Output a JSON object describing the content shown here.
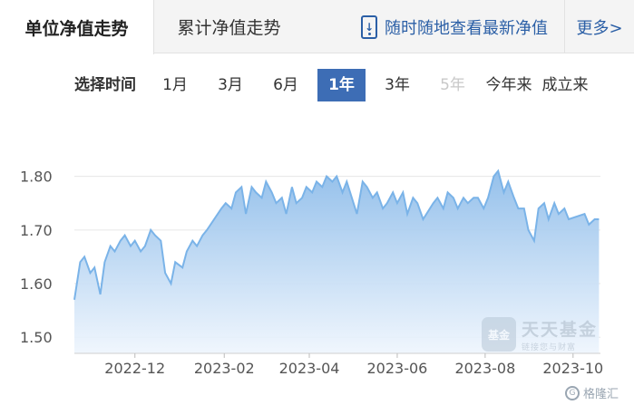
{
  "tabs": {
    "nav_trend": "单位净值走势",
    "total_trend": "累计净值走势"
  },
  "promo": {
    "label": "随时随地查看最新净值"
  },
  "more": {
    "label": "更多>"
  },
  "period": {
    "label": "选择时间",
    "options": [
      "1月",
      "3月",
      "6月",
      "1年",
      "3年",
      "5年",
      "今年来",
      "成立来"
    ],
    "selected": "1年",
    "disabled": [
      "5年"
    ]
  },
  "watermark": {
    "title": "天天基金",
    "subtitle": "链接您与财富",
    "logo_text": "基金"
  },
  "corner_badge": "格隆汇",
  "colors": {
    "line": "#7ab3e8",
    "fill_top": "#8fbdea",
    "fill_bottom": "#eef5fd",
    "active": "#3d6db5",
    "link": "#2b5fa6"
  },
  "chart_data": {
    "type": "area",
    "title": "",
    "xlabel": "",
    "ylabel": "",
    "ylim": [
      1.47,
      1.85
    ],
    "yticks": [
      1.5,
      1.6,
      1.7,
      1.8
    ],
    "ytick_labels": [
      "1.50",
      "1.60",
      "1.70",
      "1.80"
    ],
    "xticks": [
      "2022-12",
      "2023-02",
      "2023-04",
      "2023-06",
      "2023-08",
      "2023-10"
    ],
    "xlim": [
      "2022-10-20",
      "2023-10-20"
    ],
    "grid": "horizontal",
    "series": [
      {
        "x": [
          "2022-10-20",
          "2022-10-24",
          "2022-10-27",
          "2022-10-31",
          "2022-11-03",
          "2022-11-07",
          "2022-11-10",
          "2022-11-14",
          "2022-11-17",
          "2022-11-21",
          "2022-11-24",
          "2022-11-28",
          "2022-12-01",
          "2022-12-05",
          "2022-12-08",
          "2022-12-12",
          "2022-12-15",
          "2022-12-19",
          "2022-12-22",
          "2022-12-26",
          "2022-12-29",
          "2023-01-03",
          "2023-01-06",
          "2023-01-10",
          "2023-01-13",
          "2023-01-17",
          "2023-01-20",
          "2023-01-30",
          "2023-02-02",
          "2023-02-06",
          "2023-02-09",
          "2023-02-13",
          "2023-02-16",
          "2023-02-20",
          "2023-02-23",
          "2023-02-27",
          "2023-03-02",
          "2023-03-06",
          "2023-03-09",
          "2023-03-13",
          "2023-03-16",
          "2023-03-20",
          "2023-03-23",
          "2023-03-27",
          "2023-03-30",
          "2023-04-03",
          "2023-04-06",
          "2023-04-10",
          "2023-04-13",
          "2023-04-17",
          "2023-04-20",
          "2023-04-24",
          "2023-04-27",
          "2023-05-04",
          "2023-05-08",
          "2023-05-11",
          "2023-05-15",
          "2023-05-18",
          "2023-05-22",
          "2023-05-25",
          "2023-05-29",
          "2023-06-01",
          "2023-06-05",
          "2023-06-08",
          "2023-06-12",
          "2023-06-15",
          "2023-06-19",
          "2023-06-26",
          "2023-06-29",
          "2023-07-03",
          "2023-07-06",
          "2023-07-10",
          "2023-07-13",
          "2023-07-17",
          "2023-07-20",
          "2023-07-24",
          "2023-07-27",
          "2023-07-31",
          "2023-08-03",
          "2023-08-07",
          "2023-08-10",
          "2023-08-14",
          "2023-08-17",
          "2023-08-21",
          "2023-08-24",
          "2023-08-28",
          "2023-08-31",
          "2023-09-04",
          "2023-09-07",
          "2023-09-11",
          "2023-09-14",
          "2023-09-18",
          "2023-09-21",
          "2023-09-25",
          "2023-09-28",
          "2023-10-09",
          "2023-10-12",
          "2023-10-16",
          "2023-10-19"
        ],
        "values": [
          1.57,
          1.64,
          1.65,
          1.62,
          1.63,
          1.58,
          1.64,
          1.67,
          1.66,
          1.68,
          1.69,
          1.67,
          1.68,
          1.66,
          1.67,
          1.7,
          1.69,
          1.68,
          1.62,
          1.6,
          1.64,
          1.63,
          1.66,
          1.68,
          1.67,
          1.69,
          1.7,
          1.74,
          1.75,
          1.74,
          1.77,
          1.78,
          1.73,
          1.78,
          1.77,
          1.76,
          1.79,
          1.77,
          1.75,
          1.76,
          1.73,
          1.78,
          1.75,
          1.76,
          1.78,
          1.77,
          1.79,
          1.78,
          1.8,
          1.79,
          1.8,
          1.77,
          1.79,
          1.73,
          1.79,
          1.78,
          1.76,
          1.77,
          1.74,
          1.75,
          1.77,
          1.75,
          1.77,
          1.73,
          1.76,
          1.75,
          1.72,
          1.75,
          1.76,
          1.74,
          1.77,
          1.76,
          1.74,
          1.76,
          1.75,
          1.76,
          1.76,
          1.74,
          1.76,
          1.8,
          1.81,
          1.77,
          1.79,
          1.76,
          1.74,
          1.74,
          1.7,
          1.68,
          1.74,
          1.75,
          1.72,
          1.75,
          1.73,
          1.74,
          1.72,
          1.73,
          1.71,
          1.72,
          1.72
        ]
      }
    ]
  }
}
